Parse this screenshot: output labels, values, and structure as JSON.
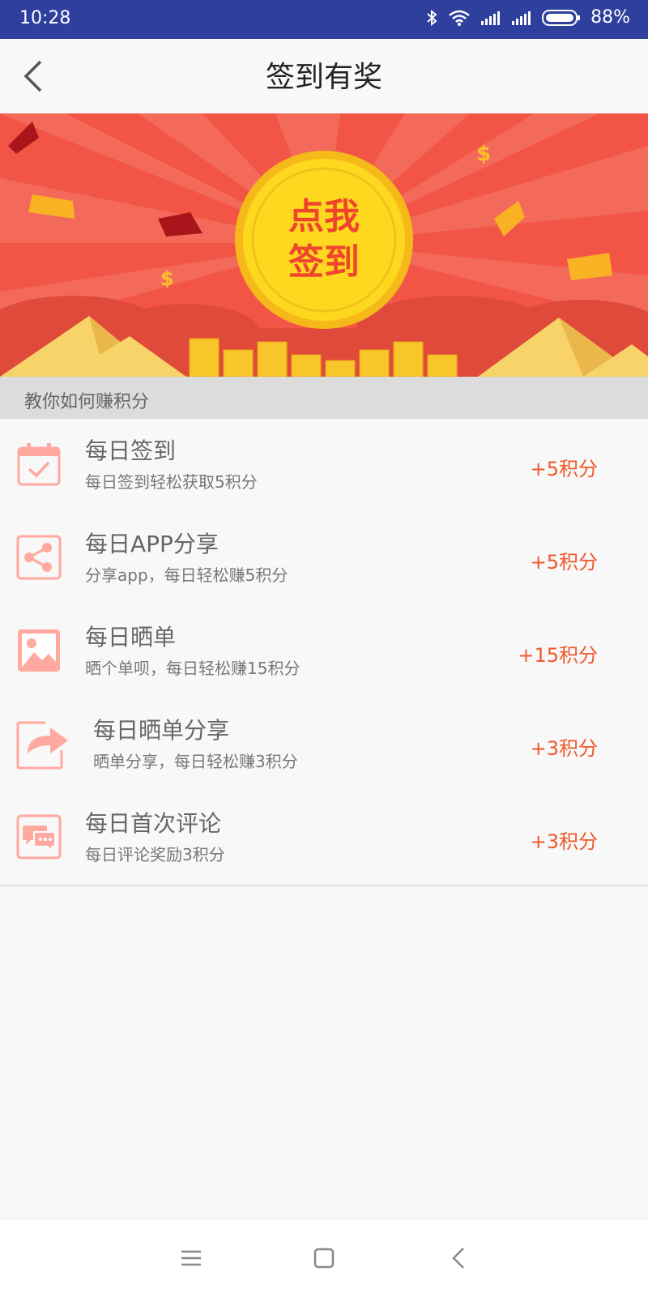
{
  "status_bar": {
    "time": "10:28",
    "battery": "88%"
  },
  "header": {
    "title": "签到有奖"
  },
  "banner": {
    "coin_line1": "点我",
    "coin_line2": "签到"
  },
  "section": {
    "title": "教你如何赚积分"
  },
  "tasks": [
    {
      "title": "每日签到",
      "subtitle": "每日签到轻松获取5积分",
      "points": "+5积分",
      "icon": "calendar-check-icon"
    },
    {
      "title": "每日APP分享",
      "subtitle": "分享app，每日轻松赚5积分",
      "points": "+5积分",
      "icon": "share-icon"
    },
    {
      "title": "每日晒单",
      "subtitle": "晒个单呗，每日轻松赚15积分",
      "points": "+15积分",
      "icon": "image-icon"
    },
    {
      "title": "每日晒单分享",
      "subtitle": "晒单分享，每日轻松赚3积分",
      "points": "+3积分",
      "icon": "forward-arrow-icon"
    },
    {
      "title": "每日首次评论",
      "subtitle": "每日评论奖励3积分",
      "points": "+3积分",
      "icon": "comment-icon"
    }
  ],
  "colors": {
    "status_bar": "#2e3f9e",
    "banner": "#f25545",
    "accent": "#f0582a",
    "icon": "#ffa9a0"
  }
}
